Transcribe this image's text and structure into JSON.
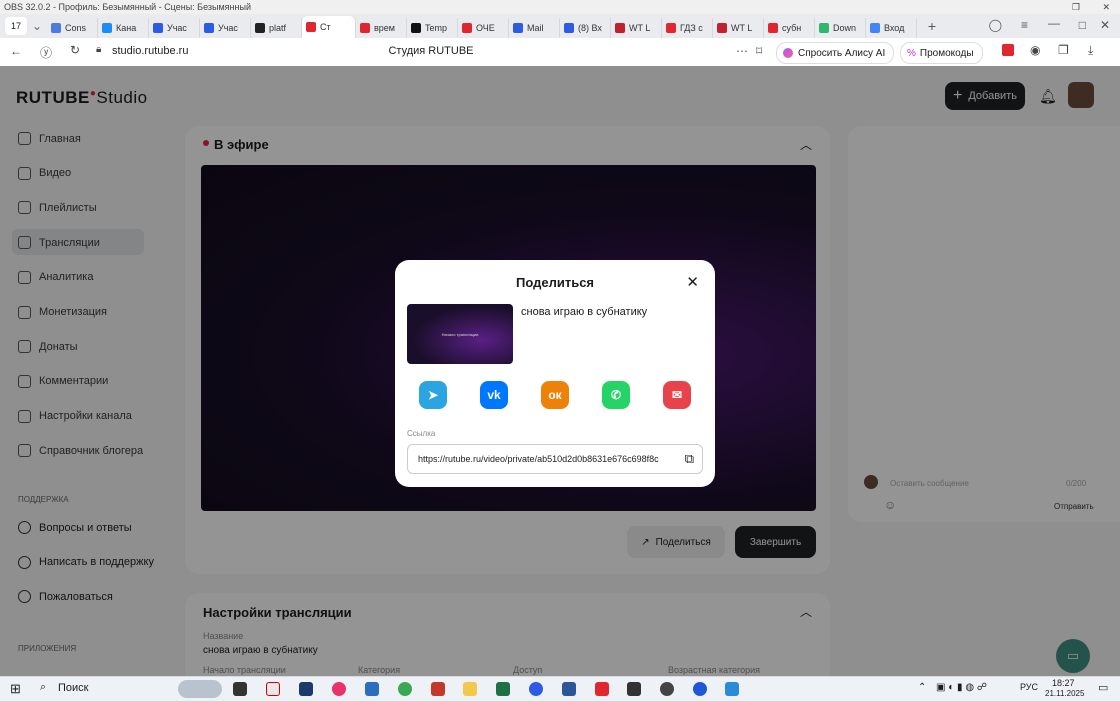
{
  "obs": {
    "title": "OBS 32.0.2 - Профиль: Безымянный - Сцены: Безымянный"
  },
  "browser": {
    "tab_counter": "17",
    "tabs": [
      "Cons",
      "Кана",
      "Учас",
      "Учас",
      "platf",
      "Ст",
      "врем",
      "Temp",
      "ОЧЕ",
      "Mail",
      "(8) Вх",
      "WT L",
      "ГДЗ с",
      "WT L",
      "субн",
      "Down",
      "Вход"
    ],
    "url": "studio.rutube.ru",
    "page_title": "Студия RUTUBE",
    "alice": "Спросить Алису AI",
    "promo": "Промокоды"
  },
  "header": {
    "logo_main": "RUTUBE",
    "logo_studio": "Studio",
    "add_button": "Добавить"
  },
  "sidebar": {
    "items": [
      "Главная",
      "Видео",
      "Плейлисты",
      "Трансляции",
      "Аналитика",
      "Монетизация",
      "Донаты",
      "Комментарии",
      "Настройки канала",
      "Справочник блогера"
    ],
    "support_title": "ПОДДЕРЖКА",
    "support_items": [
      "Вопросы и ответы",
      "Написать в поддержку",
      "Пожаловаться"
    ],
    "apps_title": "ПРИЛОЖЕНИЯ"
  },
  "live": {
    "title": "В эфире",
    "share_button": "Поделиться",
    "finish_button": "Завершить"
  },
  "chat": {
    "placeholder": "Оставить сообщение",
    "counter": "0/200",
    "send": "Отправить"
  },
  "settings": {
    "title": "Настройки трансляции",
    "name_label": "Название",
    "name_value": "снова играю в субнатику",
    "start_label": "Начало трансляции",
    "category_label": "Категория",
    "access_label": "Доступ",
    "age_label": "Возрастная категория"
  },
  "modal": {
    "title": "Поделиться",
    "video_title": "снова играю в субнатику",
    "thumb_text": "Начало трансляции",
    "link_label": "Ссылка",
    "link_value": "https://rutube.ru/video/private/ab510d2d0b8631e676c698f8c",
    "social": [
      {
        "name": "telegram",
        "color": "#2aa5e0",
        "glyph": "➤"
      },
      {
        "name": "vk",
        "color": "#0077ff",
        "glyph": "vk"
      },
      {
        "name": "odnoklassniki",
        "color": "#ee8208",
        "glyph": "ок"
      },
      {
        "name": "whatsapp",
        "color": "#25d366",
        "glyph": "✆"
      },
      {
        "name": "email",
        "color": "#e8434b",
        "glyph": "✉"
      }
    ]
  },
  "taskbar": {
    "search": "Поиск",
    "lang": "РУС",
    "time": "18:27",
    "date": "21.11.2025"
  }
}
